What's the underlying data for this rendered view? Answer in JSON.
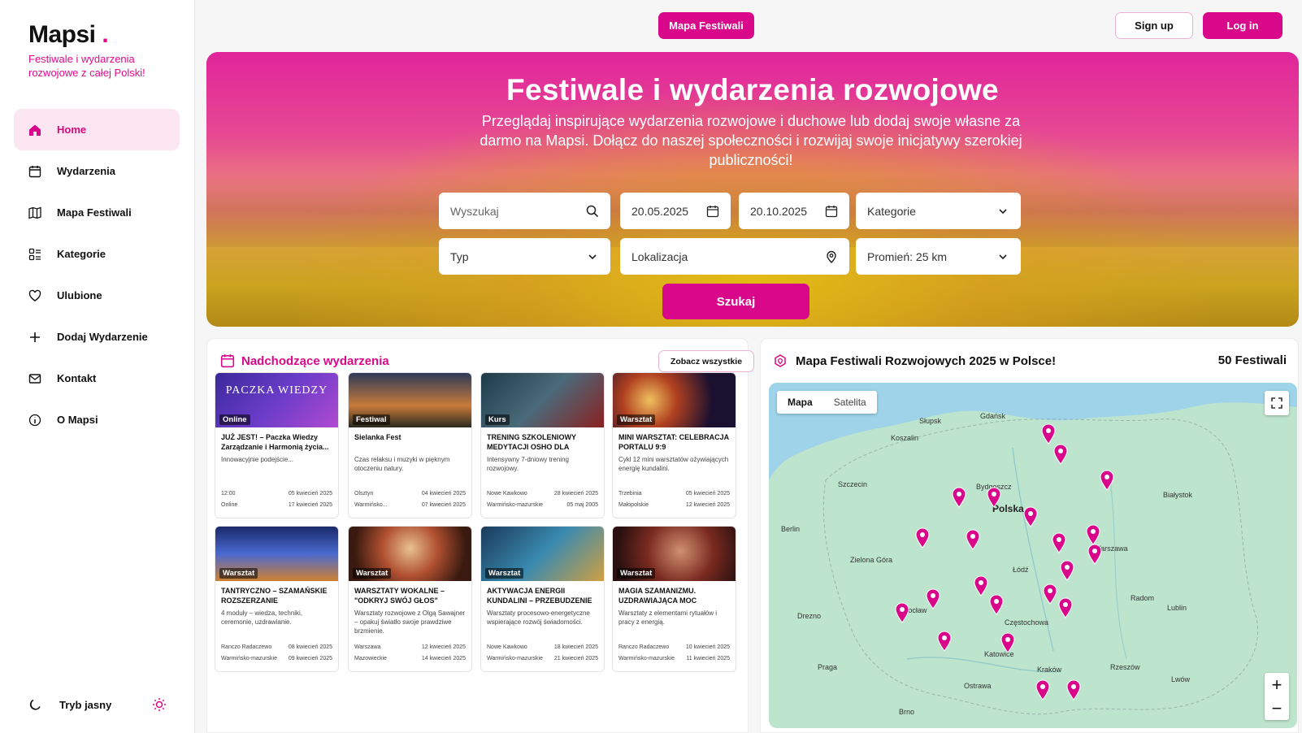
{
  "brand": {
    "name": "Mapsi",
    "dot": ".",
    "tagline": "Festiwale i wydarzenia rozwojowe z całej Polski!"
  },
  "nav": [
    {
      "label": "Home",
      "icon": "home-icon"
    },
    {
      "label": "Wydarzenia",
      "icon": "calendar-icon"
    },
    {
      "label": "Mapa Festiwali",
      "icon": "map-icon"
    },
    {
      "label": "Kategorie",
      "icon": "grid-icon"
    },
    {
      "label": "Ulubione",
      "icon": "heart-icon"
    },
    {
      "label": "Dodaj Wydarzenie",
      "icon": "plus-icon"
    },
    {
      "label": "Kontakt",
      "icon": "mail-icon"
    },
    {
      "label": "O Mapsi",
      "icon": "info-icon"
    }
  ],
  "theme": {
    "label": "Tryb jasny"
  },
  "topbar": {
    "mapa": "Mapa Festiwali",
    "signup": "Sign up",
    "login": "Log in"
  },
  "hero": {
    "title": "Festiwale i wydarzenia rozwojowe",
    "subtitle": "Przeglądaj inspirujące wydarzenia rozwojowe i duchowe lub dodaj swoje własne za darmo na Mapsi. Dołącz do naszej społeczności i rozwijaj swoje inicjatywy szerokiej publiczności!",
    "search_placeholder": "Wyszukaj",
    "date_from": "20.05.2025",
    "date_to": "20.10.2025",
    "kategorie": "Kategorie",
    "typ": "Typ",
    "lokalizacja": "Lokalizacja",
    "promien": "Promień: 25 km",
    "search_button": "Szukaj"
  },
  "events": {
    "title": "Nadchodzące wydarzenia",
    "see_all": "Zobacz wszystkie",
    "cards": [
      {
        "badge": "Online",
        "title": "JUŻ JEST! – Paczka Wiedzy Zarządzanie i Harmonią życia...",
        "desc": "Innowacyjnie podejście...",
        "place1": "12:00",
        "place2": "Online",
        "date1": "05 kwiecień 2025",
        "date2": "17 kwiecień 2025",
        "img": "linear-gradient(135deg,#3a2a9a,#6a3cc9 50%,#b04ad0)",
        "imgtext": "PACZKA WIEDZY"
      },
      {
        "badge": "Festiwal",
        "title": "Sielanka Fest",
        "desc": "Czas relaksu i muzyki w pięknym otoczeniu natury.",
        "place1": "Olsztyn",
        "place2": "Warmińsko...",
        "date1": "04 kwiecień 2025",
        "date2": "07 kwiecień 2025",
        "img": "linear-gradient(180deg,#2d3a5a,#c97a3a 60%,#2a2a20)",
        "imgtext": ""
      },
      {
        "badge": "Kurs",
        "title": "TRENING SZKOLENIOWY MEDYTACJI OSHO DLA OSÓB...",
        "desc": "Intensywny 7-dniowy trening rozwojowy.",
        "place1": "Nowe Kawkowo",
        "place2": "Warmińsko-mazurskie",
        "date1": "28 kwiecień 2025",
        "date2": "05 maj 2005",
        "img": "linear-gradient(135deg,#1c3a4a,#4a6a7a 50%,#8a2020)",
        "imgtext": ""
      },
      {
        "badge": "Warsztat",
        "title": "MINI WARSZTAT: CELEBRACJA PORTALU 9:9",
        "desc": "Cykl 12 mini warsztatów ożywiających energię kundalini.",
        "place1": "Trzebinia",
        "place2": "Małopolskie",
        "date1": "05 kwiecień 2025",
        "date2": "12 kwiecień 2025",
        "img": "radial-gradient(circle at 30% 50%,#f0c060,#b04020 30%,#1a1030 70%)",
        "imgtext": ""
      },
      {
        "badge": "Warsztat",
        "title": "TANTRYCZNO – SZAMAŃSKIE ROZSZERZANIE ŚWIADOMOŚCI",
        "desc": "4 moduły – wiedza, techniki, ceremonie, uzdrawianie.",
        "place1": "Ranczo Radaczewo",
        "place2": "Warmińsko-mazurskie",
        "date1": "08 kwiecień 2025",
        "date2": "09 kwiecień 2025",
        "img": "linear-gradient(180deg,#1a2a6a,#4a6ad0 50%,#d08030)",
        "imgtext": ""
      },
      {
        "badge": "Warsztat",
        "title": "WARSZTATY WOKALNE – \"ODKRYJ SWÓJ GŁOS\"",
        "desc": "Warsztaty rozwojowe z Olgą Sawajner – opakuj światło swoje prawdziwe brzmienie.",
        "place1": "Warszawa",
        "place2": "Mazowieckie",
        "date1": "12 kwiecień 2025",
        "date2": "14 kwiecień 2025",
        "img": "radial-gradient(circle at 50% 40%,#e8c090,#b05030 40%,#3a1a10 80%)",
        "imgtext": ""
      },
      {
        "badge": "Warsztat",
        "title": "AKTYWACJA ENERGII KUNDALINI – PRZEBUDZENIE",
        "desc": "Warsztaty procesowo-energetyczne wspierające rozwój świadomości.",
        "place1": "Nowe Kawkowo",
        "place2": "Warmińsko-mazurskie",
        "date1": "18 kwiecień 2025",
        "date2": "21 kwiecień 2025",
        "img": "linear-gradient(135deg,#1a3a5a,#3a8ab0 50%,#d0a040)",
        "imgtext": ""
      },
      {
        "badge": "Warsztat",
        "title": "MAGIA SZAMANIZMU. UZDRAWIAJĄCA MOC",
        "desc": "Warsztaty z elementami rytuałów i pracy z energią.",
        "place1": "Ranczo Radaczewo",
        "place2": "Warmińsko-mazurskie",
        "date1": "10 kwiecień 2025",
        "date2": "11 kwiecień 2025",
        "img": "radial-gradient(circle at 55% 45%,#d09070,#7a2a20 45%,#2a1010 85%)",
        "imgtext": ""
      }
    ]
  },
  "map": {
    "title": "Mapa Festiwali Rozwojowych 2025 w Polsce!",
    "count": "50 Festiwali",
    "tab_map": "Mapa",
    "tab_sat": "Satelita",
    "zoom_in": "+",
    "zoom_out": "−",
    "cities": [
      {
        "name": "Gdańsk"
      },
      {
        "name": "Słupsk"
      },
      {
        "name": "Koszalin"
      },
      {
        "name": "Szczecin"
      },
      {
        "name": "Bydgoszcz"
      },
      {
        "name": "Polska",
        "big": true
      },
      {
        "name": "Białystok"
      },
      {
        "name": "Berlin"
      },
      {
        "name": "Zielona Góra"
      },
      {
        "name": "Łódź"
      },
      {
        "name": "Warszawa"
      },
      {
        "name": "Wrocław"
      },
      {
        "name": "Radom"
      },
      {
        "name": "Lublin"
      },
      {
        "name": "Częstochowa"
      },
      {
        "name": "Drezno"
      },
      {
        "name": "Katowice"
      },
      {
        "name": "Kraków"
      },
      {
        "name": "Praga"
      },
      {
        "name": "Ostrawa"
      },
      {
        "name": "Brno"
      },
      {
        "name": "Rzeszów"
      },
      {
        "name": "Lwów"
      }
    ]
  },
  "colors": {
    "accent": "#d9088a",
    "accent_light": "#fbe6f1",
    "map_land": "#bde4cc",
    "map_sea": "#9ed3ea"
  }
}
